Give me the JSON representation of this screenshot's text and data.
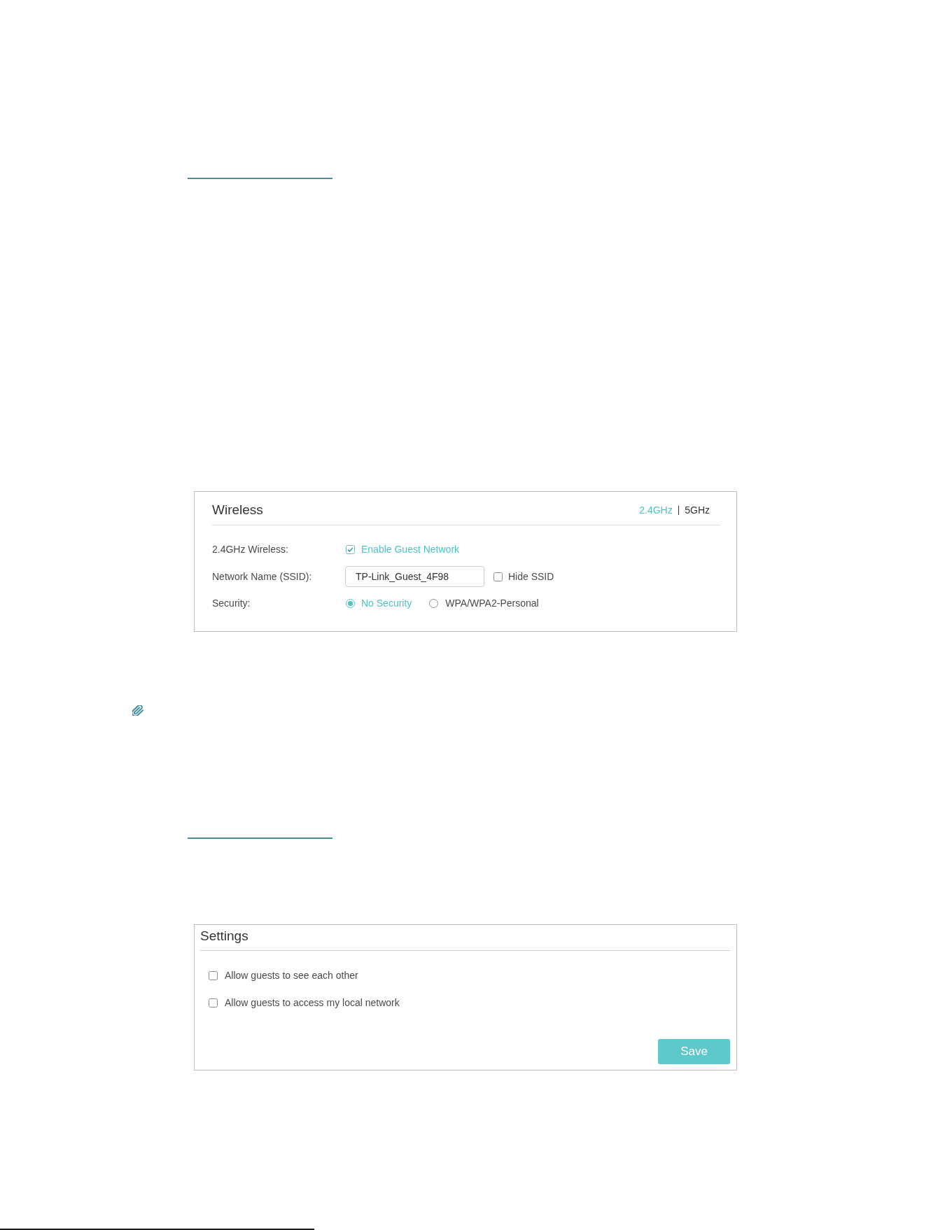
{
  "wireless_panel": {
    "title": "Wireless",
    "band_tabs": [
      {
        "label": "2.4GHz",
        "selected": true
      },
      {
        "label": "5GHz",
        "selected": false
      }
    ],
    "rows": [
      {
        "kind": "checkbox",
        "label": "2.4GHz Wireless:",
        "options": [
          {
            "label": "Enable Guest Network",
            "checked": true
          }
        ]
      },
      {
        "kind": "text",
        "label": "Network Name (SSID):",
        "value": "TP-Link_Guest_4F98",
        "options": [
          {
            "label": "Hide SSID",
            "checked": false
          }
        ]
      },
      {
        "kind": "radio",
        "label": "Security:",
        "options": [
          {
            "label": "No Security",
            "selected": true
          },
          {
            "label": "WPA/WPA2-Personal",
            "selected": false
          }
        ]
      }
    ]
  },
  "settings_panel": {
    "title": "Settings",
    "options": [
      {
        "label": "Allow guests to see each other",
        "checked": false
      },
      {
        "label": "Allow guests to access my local network",
        "checked": false
      }
    ],
    "save_button": "Save"
  }
}
